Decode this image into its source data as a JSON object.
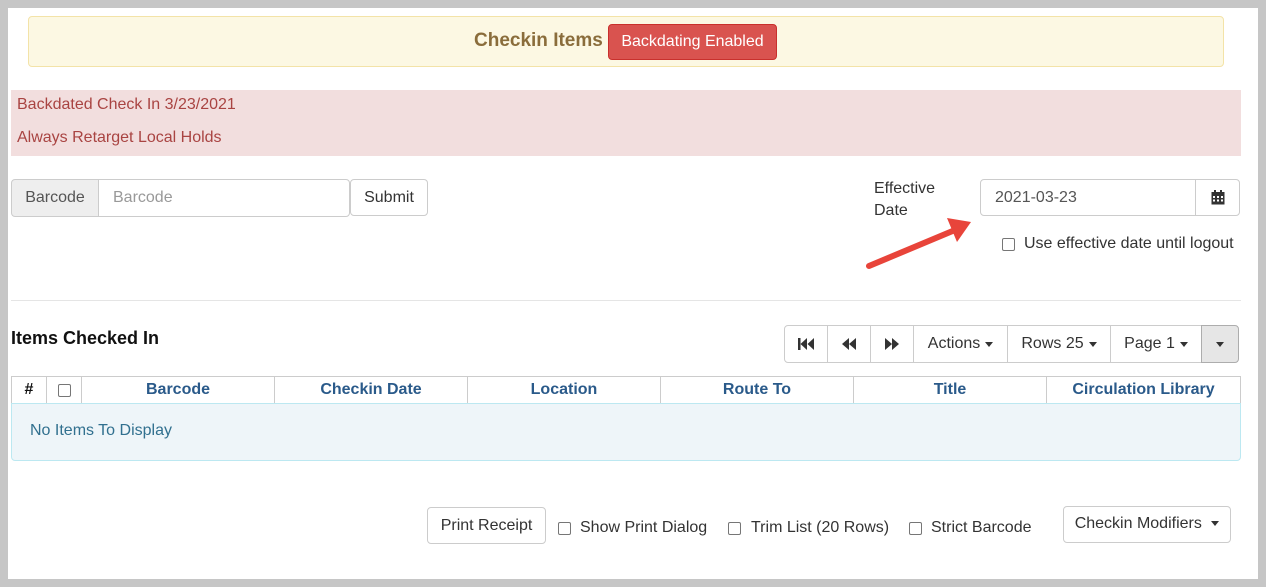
{
  "header": {
    "title": "Checkin Items",
    "backdate_badge": "Backdating Enabled"
  },
  "alert": {
    "line1": "Backdated Check In 3/23/2021",
    "line2": "Always Retarget Local Holds"
  },
  "barcode": {
    "addon_label": "Barcode",
    "placeholder": "Barcode",
    "value": "",
    "submit_label": "Submit"
  },
  "effective_date": {
    "label": "Effective Date",
    "value": "2021-03-23",
    "until_logout_label": "Use effective date until logout"
  },
  "grid": {
    "title": "Items Checked In",
    "pager": {
      "actions_label": "Actions",
      "rows_label": "Rows 25",
      "page_label": "Page 1"
    },
    "columns": [
      "#",
      "",
      "Barcode",
      "Checkin Date",
      "Location",
      "Route To",
      "Title",
      "Circulation Library"
    ],
    "empty_message": "No Items To Display"
  },
  "footer": {
    "print_receipt": "Print Receipt",
    "show_print_dialog": "Show Print Dialog",
    "trim_list": "Trim List (20 Rows)",
    "strict_barcode": "Strict Barcode",
    "checkin_modifiers": "Checkin Modifiers"
  },
  "colors": {
    "banner_bg": "#fcf8e3",
    "badge_danger": "#d9534f",
    "alert_bg": "#f2dede",
    "alert_text": "#a94442",
    "grid_header_text": "#2a5a8a",
    "empty_bg": "#eef5f9",
    "annotation_arrow": "#e8443a"
  }
}
